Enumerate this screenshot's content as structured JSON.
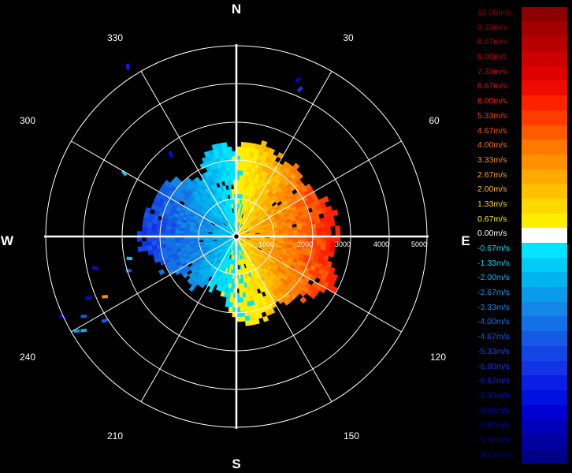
{
  "directions": {
    "north": "N",
    "south": "S",
    "east": "E",
    "west": "W"
  },
  "bearings": [
    "330",
    "30",
    "300",
    "60",
    "240",
    "120",
    "210",
    "150"
  ],
  "range_labels": [
    "1000",
    "2000",
    "3000",
    "4000",
    "5000"
  ],
  "legend": [
    {
      "label": "10.00m/s",
      "color": "#8b0000"
    },
    {
      "label": "9.33m/s",
      "color": "#a30000"
    },
    {
      "label": "8.67m/s",
      "color": "#b80000"
    },
    {
      "label": "8.00m/s",
      "color": "#cc0000"
    },
    {
      "label": "7.33m/s",
      "color": "#e00000"
    },
    {
      "label": "6.67m/s",
      "color": "#f00a00"
    },
    {
      "label": "6.00m/s",
      "color": "#ff2200"
    },
    {
      "label": "5.33m/s",
      "color": "#ff3c00"
    },
    {
      "label": "4.67m/s",
      "color": "#ff5a00"
    },
    {
      "label": "4.00m/s",
      "color": "#ff7800"
    },
    {
      "label": "3.33m/s",
      "color": "#ff9000"
    },
    {
      "label": "2.67m/s",
      "color": "#ffaa00"
    },
    {
      "label": "2.00m/s",
      "color": "#ffc000"
    },
    {
      "label": "1.33m/s",
      "color": "#ffd800"
    },
    {
      "label": "0.67m/s",
      "color": "#ffee00"
    },
    {
      "label": "0.00m/s",
      "color": "#ffffff"
    },
    {
      "label": "-0.67m/s",
      "color": "#00e5ff"
    },
    {
      "label": "-1.33m/s",
      "color": "#00ccf5"
    },
    {
      "label": "-2.00m/s",
      "color": "#00b4f0"
    },
    {
      "label": "-2.67m/s",
      "color": "#0a9ceb"
    },
    {
      "label": "-3.33m/s",
      "color": "#1486e6"
    },
    {
      "label": "-4.00m/s",
      "color": "#1470e6"
    },
    {
      "label": "-4.67m/s",
      "color": "#145ae6"
    },
    {
      "label": "-5.33m/s",
      "color": "#1446e6"
    },
    {
      "label": "-6.00m/s",
      "color": "#1432e6"
    },
    {
      "label": "-6.67m/s",
      "color": "#0a1ee6"
    },
    {
      "label": "-7.33m/s",
      "color": "#0010e0"
    },
    {
      "label": "-8.00m/s",
      "color": "#0000d0"
    },
    {
      "label": "-8.67m/s",
      "color": "#0000b8"
    },
    {
      "label": "-9.33m/s",
      "color": "#0000a0"
    },
    {
      "label": "-10.00m/s",
      "color": "#000088"
    }
  ],
  "colors": {
    "background": "#000000",
    "grid": "#ffffff",
    "zero": "#ffffff"
  }
}
